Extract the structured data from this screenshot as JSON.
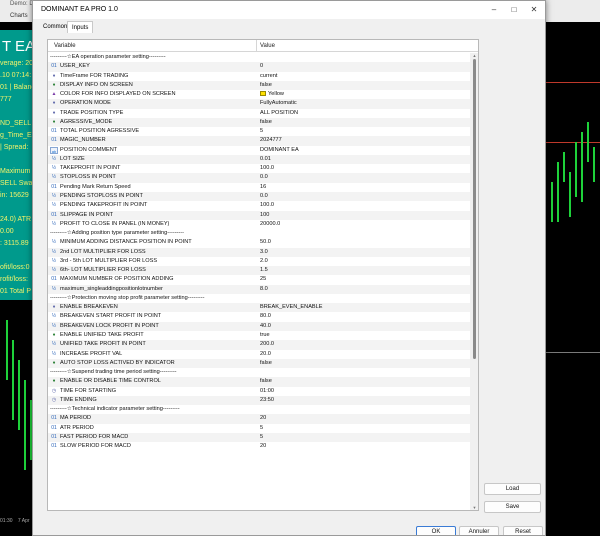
{
  "background": {
    "window_title": "Demo: Dele",
    "menu_label": "Charts",
    "ea_title": "T EA",
    "panel_lines": [
      "verage: 20",
      ".10 07:14:",
      "01 | Balanc",
      "777",
      "",
      "ND_SELL",
      "g_Time_E",
      "| Spread:",
      "",
      "Maximum",
      "SELL Swa",
      "in: 15629",
      "",
      "24.0) ATR",
      "0.00",
      ": 3115.89",
      "",
      "ofit/loss:0",
      "rofit/loss:",
      "01 Total P"
    ],
    "axis_labels": [
      "01:30",
      "7 Apr"
    ]
  },
  "dialog": {
    "title": "DOMINANT EA PRO 1.0",
    "tabs": {
      "common": "Common",
      "inputs": "Inputs"
    },
    "columns": {
      "variable": "Variable",
      "value": "Value"
    },
    "buttons": {
      "load": "Load",
      "save": "Save",
      "ok": "OK",
      "cancel": "Annuler",
      "reset": "Reset"
    }
  },
  "rows": [
    {
      "name": "---------☆EA operation parameter setting---------",
      "value": "",
      "type": "section"
    },
    {
      "name": "USER_KEY",
      "value": "0",
      "type": "num"
    },
    {
      "name": "TimeFrame FOR TRADING",
      "value": "current",
      "type": "enum"
    },
    {
      "name": "DISPLAY INFO ON SCREEN",
      "value": "false",
      "type": "bool"
    },
    {
      "name": "COLOR FOR INFO DISPLAYED ON SCREEN",
      "value": "Yellow",
      "type": "color"
    },
    {
      "name": "OPERATION MODE",
      "value": "FullyAutomatic",
      "type": "enum"
    },
    {
      "name": "TRADE POSITION TYPE",
      "value": "ALL POSITION",
      "type": "enum"
    },
    {
      "name": "AGRESSIVE_MODE",
      "value": "false",
      "type": "bool"
    },
    {
      "name": "TOTAL POSITION AGRESSIVE",
      "value": "5",
      "type": "num"
    },
    {
      "name": "MAGIC_NUMBER",
      "value": "2024777",
      "type": "num"
    },
    {
      "name": "POSITION COMMENT",
      "value": "DOMINANT EA",
      "type": "ab"
    },
    {
      "name": "LOT SIZE",
      "value": "0.01",
      "type": "dbl"
    },
    {
      "name": "TAKEPROFIT IN POINT",
      "value": "100.0",
      "type": "dbl"
    },
    {
      "name": "STOPLOSS IN POINT",
      "value": "0.0",
      "type": "dbl"
    },
    {
      "name": "Pending Mark Return Speed",
      "value": "16",
      "type": "num"
    },
    {
      "name": "PENDING STOPLOSS IN POINT",
      "value": "0.0",
      "type": "dbl"
    },
    {
      "name": "PENDING TAKEPROFIT IN POINT",
      "value": "100.0",
      "type": "dbl"
    },
    {
      "name": "SLIPPAGE IN POINT",
      "value": "100",
      "type": "num"
    },
    {
      "name": "PROFIT TO CLOSE IN PANEL (IN MONEY)",
      "value": "20000.0",
      "type": "dbl"
    },
    {
      "name": "---------☆Adding position type parameter setting---------",
      "value": "",
      "type": "section"
    },
    {
      "name": "MINIMUM ADDING DISTANCE POSITION IN POINT",
      "value": "50.0",
      "type": "dbl"
    },
    {
      "name": "2nd LOT MULTIPLIER FOR  LOSS",
      "value": "3.0",
      "type": "dbl"
    },
    {
      "name": "3rd - 5th LOT MULTIPLIER FOR  LOSS",
      "value": "2.0",
      "type": "dbl"
    },
    {
      "name": "6th- LOT MULTIPLIER FOR  LOSS",
      "value": "1.5",
      "type": "dbl"
    },
    {
      "name": "MAXIMUM NUMBER OF POSITION ADDING",
      "value": "25",
      "type": "num"
    },
    {
      "name": "maximum_singleaddingpositionlotnumber",
      "value": "8.0",
      "type": "dbl"
    },
    {
      "name": "---------☆Protection moving stop profit parameter setting---------",
      "value": "",
      "type": "section"
    },
    {
      "name": "ENABLE BREAKEVEN",
      "value": "BREAK_EVEN_ENABLE",
      "type": "enum"
    },
    {
      "name": "BREAKEVEN START PROFIT IN POINT",
      "value": "80.0",
      "type": "dbl"
    },
    {
      "name": "BREAKEVEN LOCK PROFIT IN POINT",
      "value": "40.0",
      "type": "dbl"
    },
    {
      "name": "ENABLE UNIFIED TAKE PROFIT",
      "value": "true",
      "type": "bool"
    },
    {
      "name": "UNIFIED TAKE PROFIT IN POINT",
      "value": "200.0",
      "type": "dbl"
    },
    {
      "name": "INCREASE PROFIT VAL",
      "value": "20.0",
      "type": "dbl"
    },
    {
      "name": "AUTO STOP LOSS ACTIVED BY INDICATOR",
      "value": "false",
      "type": "bool"
    },
    {
      "name": "---------☆Suspend trading time period setting---------",
      "value": "",
      "type": "section"
    },
    {
      "name": "ENABLE OR DISABLE TIME CONTROL",
      "value": "false",
      "type": "bool"
    },
    {
      "name": "TIME FOR STARTING",
      "value": "01:00",
      "type": "time"
    },
    {
      "name": "TIME ENDING",
      "value": "23:50",
      "type": "time"
    },
    {
      "name": "---------☆Technical indicator parameter setting---------",
      "value": "",
      "type": "section"
    },
    {
      "name": "MA PERIOD",
      "value": "20",
      "type": "num"
    },
    {
      "name": "ATR PERIOD",
      "value": "5",
      "type": "num"
    },
    {
      "name": "FAST PERIOD FOR MACD",
      "value": "5",
      "type": "num"
    },
    {
      "name": "SLOW PERIOD FOR MACD",
      "value": "20",
      "type": "num"
    }
  ],
  "icons": {
    "num": "01",
    "enum": "♦",
    "bool": "♦",
    "color": "▲",
    "ab": "ab",
    "dbl": "½",
    "time": "◷"
  },
  "colors": {
    "swatch": "#ffe000",
    "panel": "#009a8c",
    "panel_text": "#f3f36a"
  }
}
